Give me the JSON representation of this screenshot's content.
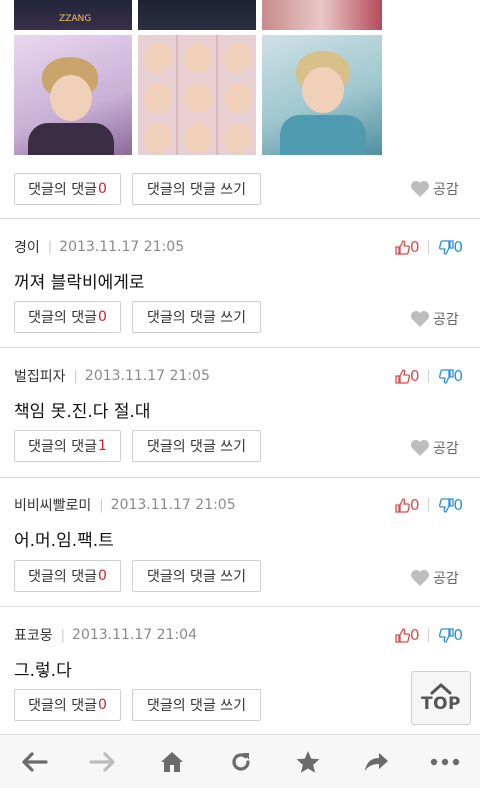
{
  "collage": {
    "tile_text": "ZZANG"
  },
  "labels": {
    "reply_prefix": "댓글의 댓글",
    "write_reply": "댓글의 댓글 쓰기",
    "like": "공감",
    "top": "TOP"
  },
  "first_block": {
    "reply_count": "0"
  },
  "comments": [
    {
      "author": "경이",
      "date": "2013.11.17 21:05",
      "text": "꺼져 블락비에게로",
      "reply_count": "0",
      "up": "0",
      "down": "0"
    },
    {
      "author": "벌집피자",
      "date": "2013.11.17 21:05",
      "text": "책임 못.진.다 절.대",
      "reply_count": "1",
      "up": "0",
      "down": "0"
    },
    {
      "author": "비비씨빨로미",
      "date": "2013.11.17 21:05",
      "text": "어.머.임.팩.트",
      "reply_count": "0",
      "up": "0",
      "down": "0"
    },
    {
      "author": "표코뭉",
      "date": "2013.11.17 21:04",
      "text": "그.렇.다",
      "reply_count": "0",
      "up": "0",
      "down": "0"
    }
  ],
  "navbar": {
    "icons": [
      "back-arrow-icon",
      "forward-arrow-icon",
      "home-icon",
      "refresh-icon",
      "bookmark-star-icon",
      "share-icon",
      "more-icon"
    ]
  },
  "colors": {
    "count": "#cc2222",
    "up": "#e04848",
    "down": "#2c8fd6",
    "like_heart": "#bdbdbd"
  }
}
